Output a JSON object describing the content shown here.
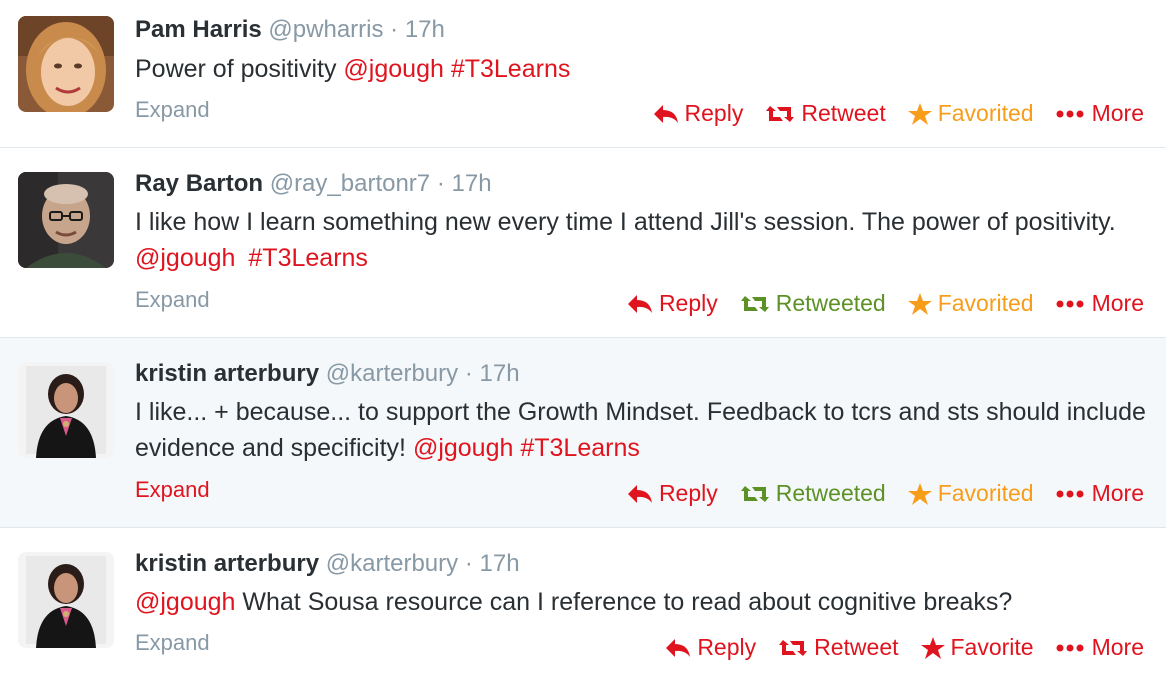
{
  "colors": {
    "link": "#e0141e",
    "retweeted": "#5c9126",
    "favorited": "#f89d1a",
    "muted": "#8899a6",
    "text": "#292f33"
  },
  "tweets": [
    {
      "fullname": "Pam Harris",
      "username": "@pwharris",
      "dot": "·",
      "time": "17h",
      "text": "Power of positivity",
      "mention": "@jgough",
      "hashtag": "#T3Learns",
      "expand": "Expand",
      "reply": "Reply",
      "retweet": "Retweet",
      "favorite": "Favorited",
      "more": "More",
      "avatar_icon": "avatar-woman-blonde"
    },
    {
      "fullname": "Ray Barton",
      "username": "@ray_bartonr7",
      "dot": "·",
      "time": "17h",
      "text": "I like how I learn something new every time I attend Jill's session. The power of positivity.",
      "mention": "@jgough",
      "hashtag": "#T3Learns",
      "expand": "Expand",
      "reply": "Reply",
      "retweet": "Retweeted",
      "favorite": "Favorited",
      "more": "More",
      "avatar_icon": "avatar-man-glasses"
    },
    {
      "fullname": "kristin arterbury",
      "username": "@karterbury",
      "dot": "·",
      "time": "17h",
      "text": "I like... + because... to support the Growth Mindset. Feedback to tcrs and sts should include evidence and specificity!",
      "mention": "@jgough",
      "hashtag": "#T3Learns",
      "expand": "Expand",
      "reply": "Reply",
      "retweet": "Retweeted",
      "favorite": "Favorited",
      "more": "More",
      "avatar_icon": "avatar-woman-dark-hair"
    },
    {
      "fullname": "kristin arterbury",
      "username": "@karterbury",
      "dot": "·",
      "time": "17h",
      "mention": "@jgough",
      "text": "What Sousa resource can I reference to read about cognitive breaks?",
      "expand": "Expand",
      "reply": "Reply",
      "retweet": "Retweet",
      "favorite": "Favorite",
      "more": "More",
      "avatar_icon": "avatar-woman-dark-hair"
    }
  ]
}
